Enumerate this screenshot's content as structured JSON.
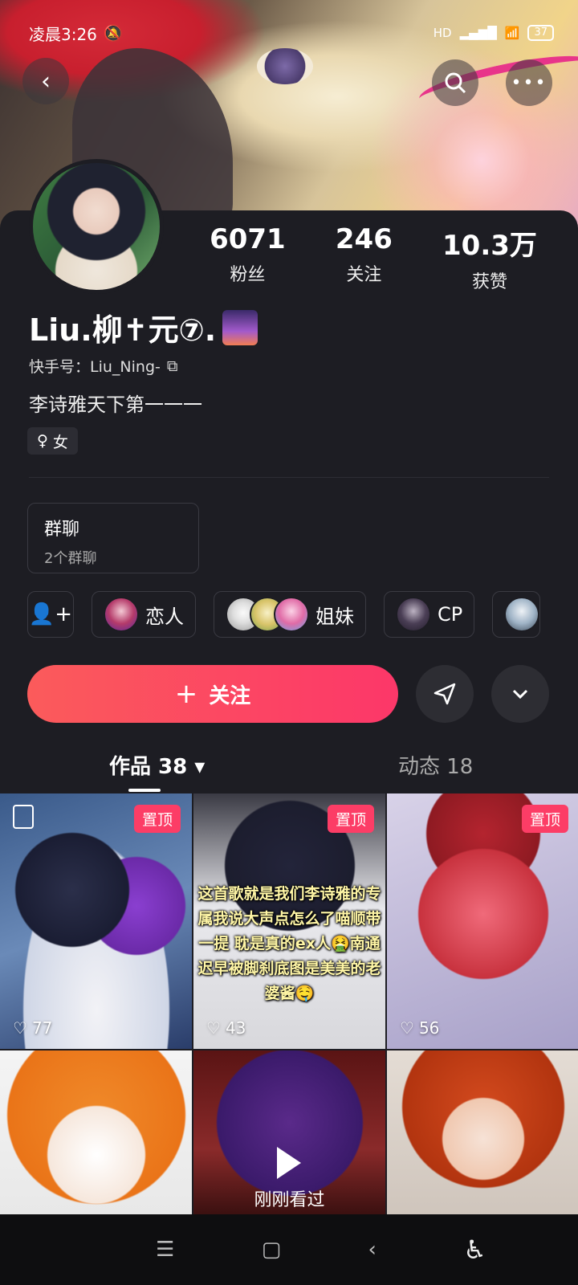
{
  "status_bar": {
    "time": "凌晨3:26",
    "network": "HD",
    "battery": "37"
  },
  "profile": {
    "stats": [
      {
        "value": "6071",
        "label": "粉丝"
      },
      {
        "value": "246",
        "label": "关注"
      },
      {
        "value": "10.3万",
        "label": "获赞"
      }
    ],
    "name": "Liu.柳✝元⑦.",
    "kuaishou_id": "快手号：Liu_Ning-",
    "bio": "李诗雅天下第一一一",
    "gender": "女"
  },
  "group_chat": {
    "title": "群聊",
    "subtitle": "2个群聊"
  },
  "relations": [
    {
      "label": "恋人"
    },
    {
      "label": "姐妹"
    },
    {
      "label": "CP"
    }
  ],
  "actions": {
    "follow_label": "关注"
  },
  "tabs": [
    {
      "label": "作品 38"
    },
    {
      "label": "动态 18"
    }
  ],
  "works": [
    {
      "pinned": "置顶",
      "likes": "77"
    },
    {
      "pinned": "置顶",
      "likes": "43",
      "caption": "这首歌就是我们李诗雅的专属我说大声点怎么了喵顺带一提 耽是真的ex人🤮南通迟早被脚刹底图是美美的老婆酱🤤"
    },
    {
      "pinned": "置顶",
      "likes": "56"
    },
    {},
    {
      "badge": "刚刚看过"
    },
    {}
  ]
}
